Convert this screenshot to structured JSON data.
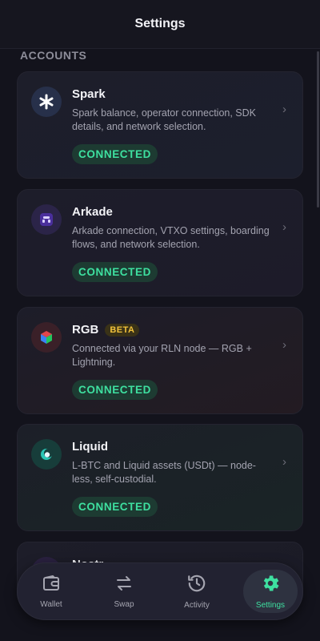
{
  "header": {
    "title": "Settings"
  },
  "section": {
    "label": "ACCOUNTS"
  },
  "accounts": [
    {
      "name": "Spark",
      "description": "Spark balance, operator connection, SDK details, and network selection.",
      "status": "CONNECTED",
      "icon": "spark-asterisk-icon"
    },
    {
      "name": "Arkade",
      "description": "Arkade connection, VTXO settings, boarding flows, and network selection.",
      "status": "CONNECTED",
      "icon": "arkade-logo-icon"
    },
    {
      "name": "RGB",
      "badge": "BETA",
      "description": "Connected via your RLN node — RGB + Lightning.",
      "status": "CONNECTED",
      "icon": "rgb-cube-icon"
    },
    {
      "name": "Liquid",
      "description": "L-BTC and Liquid assets (USDt) — node-less, self-custodial.",
      "status": "CONNECTED",
      "icon": "liquid-moon-icon"
    },
    {
      "name": "Nostr",
      "icon": "nostr-icon"
    }
  ],
  "nav": {
    "items": [
      {
        "label": "Wallet",
        "icon": "wallet-icon",
        "active": false
      },
      {
        "label": "Swap",
        "icon": "swap-arrows-icon",
        "active": false
      },
      {
        "label": "Activity",
        "icon": "history-clock-icon",
        "active": false
      },
      {
        "label": "Settings",
        "icon": "gear-icon",
        "active": true
      }
    ]
  },
  "colors": {
    "accent": "#3ee0a0",
    "background": "#13131c",
    "beta": "#f2c23b"
  }
}
